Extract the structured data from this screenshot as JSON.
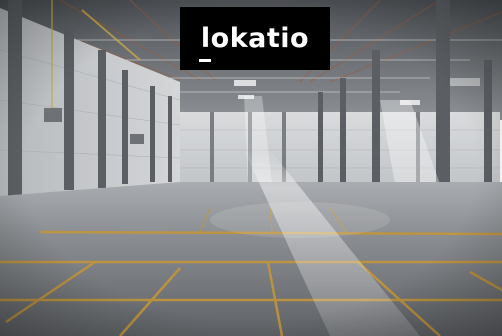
{
  "logo": {
    "text": "lokatio",
    "background_color": "#000000",
    "text_color": "#ffffff"
  },
  "scene": {
    "subject": "empty-warehouse-hall",
    "colors": {
      "floor": "#7d8084",
      "floor_lines": "#b58a2a",
      "walls": "#c9cbcd",
      "ceiling": "#6f7377",
      "columns": "#5b5f63",
      "light": "#f2f2ee"
    }
  }
}
